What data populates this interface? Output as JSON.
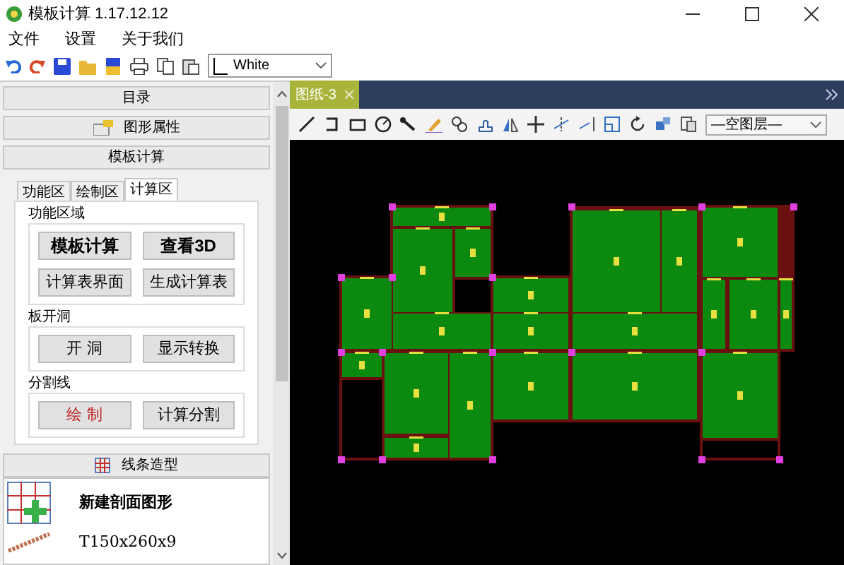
{
  "window": {
    "title": "模板计算 1.17.12.12"
  },
  "menu": [
    "文件",
    "设置",
    "关于我们"
  ],
  "toolbar": {
    "color_select": "White"
  },
  "sidebar": {
    "sections": [
      "目录",
      "图形属性",
      "模板计算"
    ],
    "tabs": [
      {
        "label": "功能区",
        "selected": false
      },
      {
        "label": "绘制区",
        "selected": false
      },
      {
        "label": "计算区",
        "selected": true
      }
    ],
    "groups": [
      {
        "title": "功能区域",
        "buttons": [
          {
            "label": "模板计算",
            "kind": "bold"
          },
          {
            "label": "查看3D",
            "kind": "bold"
          },
          {
            "label": "计算表界面",
            "kind": "plain"
          },
          {
            "label": "生成计算表",
            "kind": "plain"
          }
        ]
      },
      {
        "title": "板开洞",
        "buttons": [
          {
            "label": "开 洞",
            "kind": "plain"
          },
          {
            "label": "显示转换",
            "kind": "plain"
          }
        ]
      },
      {
        "title": "分割线",
        "buttons": [
          {
            "label": "绘 制",
            "kind": "accent"
          },
          {
            "label": "计算分割",
            "kind": "plain"
          }
        ]
      }
    ],
    "line_section": {
      "label": "线条造型",
      "items": [
        {
          "label": "新建剖面图形",
          "kind": "new"
        },
        {
          "label": "T150x260x9",
          "kind": "profile"
        }
      ]
    }
  },
  "document_tabs": [
    {
      "label": "图纸-3",
      "selected": true
    }
  ],
  "drawing_toolbar": {
    "layer_select": "—空图层—"
  }
}
